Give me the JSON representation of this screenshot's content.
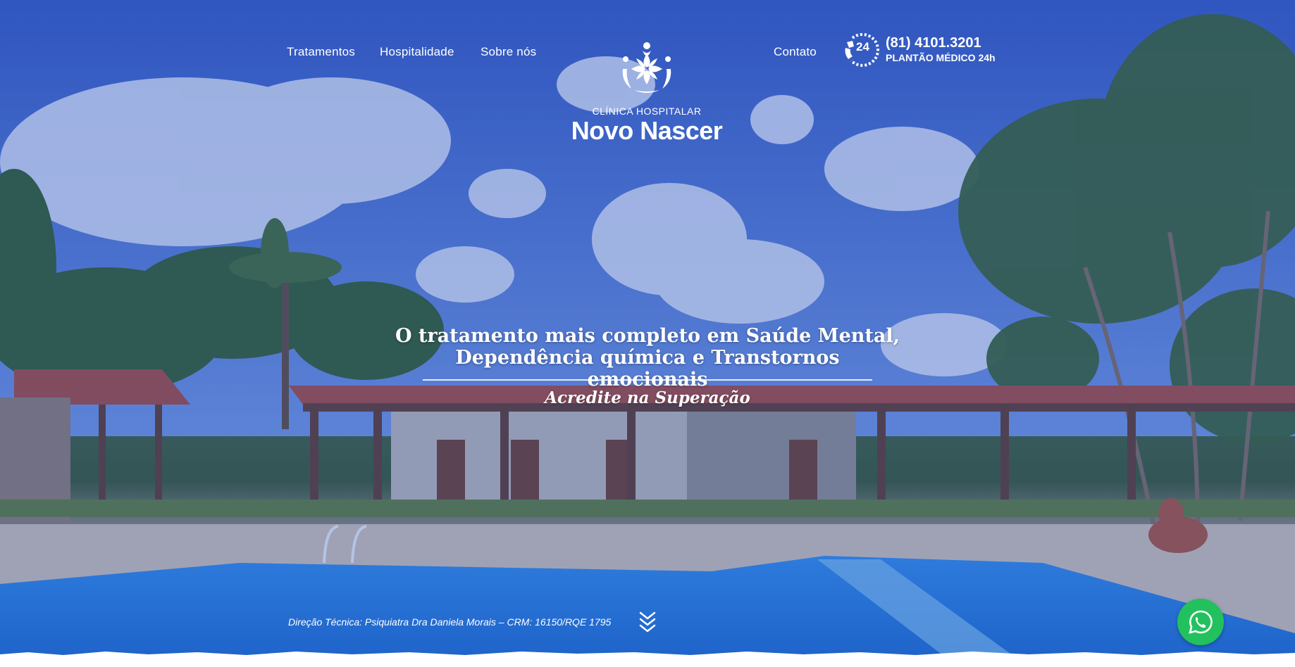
{
  "nav": {
    "left": [
      {
        "label": "Tratamentos"
      },
      {
        "label": "Hospitalidade"
      },
      {
        "label": "Sobre nós"
      }
    ],
    "right": [
      {
        "label": "Contato"
      }
    ]
  },
  "logo": {
    "kicker": "CLÍNICA HOSPITALAR",
    "name": "Novo Nascer",
    "icon": "flower-emblem-icon"
  },
  "phone": {
    "icon": "24h-phone-icon",
    "badge": "24",
    "number": "(81) 4101.3201",
    "subtitle": "PLANTÃO MÉDICO 24h"
  },
  "hero": {
    "headline_line1": "O tratamento mais completo em Saúde Mental,",
    "headline_line2": "Dependência química e Transtornos emocionais",
    "tagline": "Acredite na Superação"
  },
  "footer": {
    "direction": "Direção Técnica: Psiquiatra Dra Daniela Morais – CRM: 16150/RQE 1795"
  },
  "icons": {
    "scroll": "chevron-down-triple-icon",
    "whatsapp": "whatsapp-icon"
  },
  "colors": {
    "overlay": "#3456be",
    "whatsapp": "#22c15e",
    "text": "#ffffff"
  }
}
